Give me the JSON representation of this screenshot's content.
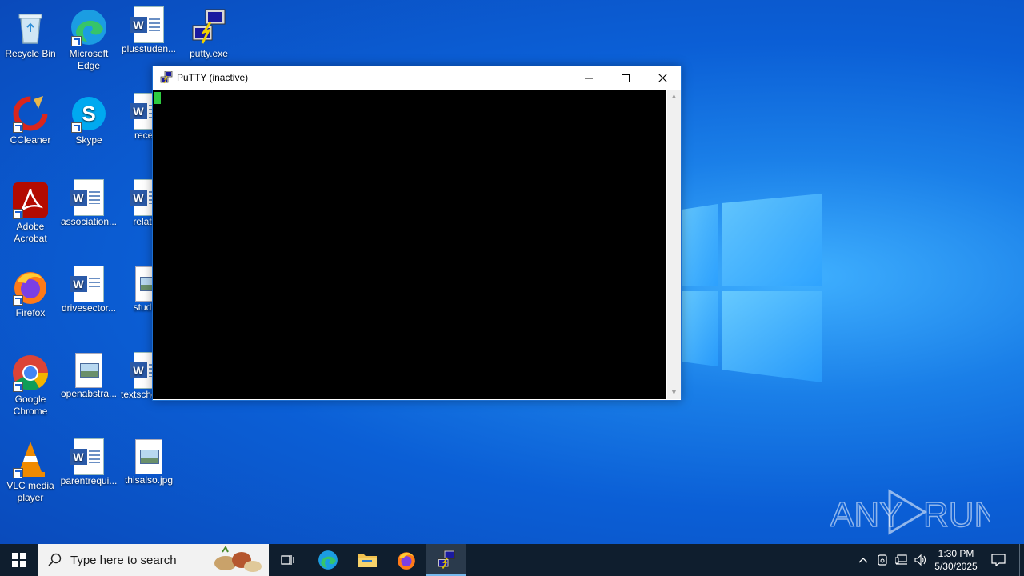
{
  "desktop": {
    "icons": [
      {
        "label": "Recycle Bin"
      },
      {
        "label": "Microsoft Edge"
      },
      {
        "label": "plusstuden..."
      },
      {
        "label": "putty.exe"
      },
      {
        "label": "CCleaner"
      },
      {
        "label": "Skype"
      },
      {
        "label": "recentl"
      },
      {
        "label": "Adobe Acrobat"
      },
      {
        "label": "association..."
      },
      {
        "label": "relation"
      },
      {
        "label": "Firefox"
      },
      {
        "label": "drivesector..."
      },
      {
        "label": "studiop"
      },
      {
        "label": "Google Chrome"
      },
      {
        "label": "openabstra..."
      },
      {
        "label": "textschools..."
      },
      {
        "label": "VLC media player"
      },
      {
        "label": "parentrequi..."
      },
      {
        "label": "thisalso.jpg"
      }
    ]
  },
  "window": {
    "title": "PuTTY (inactive)",
    "minimize_icon": "minimize-icon",
    "maximize_icon": "maximize-icon",
    "close_icon": "close-icon",
    "terminal_bg": "#000000",
    "cursor_color": "#2ecc40"
  },
  "watermark": {
    "text_left": "ANY",
    "text_right": "RUN"
  },
  "taskbar": {
    "search_placeholder": "Type here to search",
    "clock_time": "1:30 PM",
    "clock_date": "5/30/2025",
    "accent": "#76b9ed"
  }
}
